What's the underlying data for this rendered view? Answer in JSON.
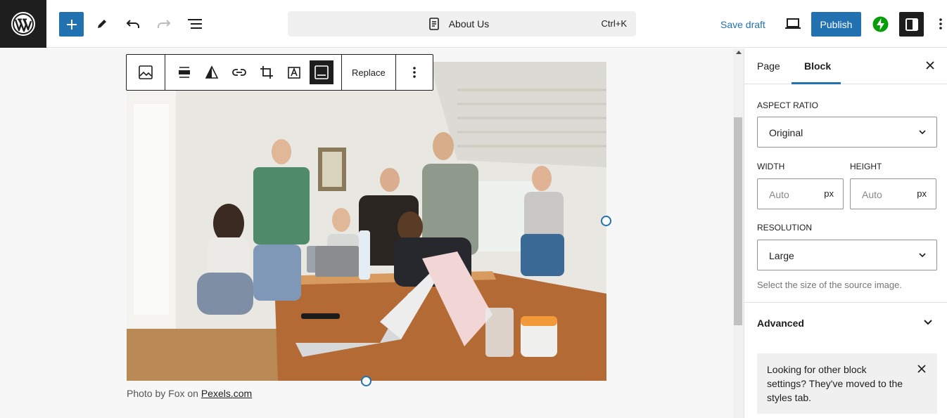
{
  "header": {
    "document_title": "About Us",
    "shortcut": "Ctrl+K",
    "save_draft_label": "Save draft",
    "publish_label": "Publish"
  },
  "block_toolbar": {
    "replace_label": "Replace"
  },
  "image": {
    "caption_prefix": "Photo by Fox on ",
    "caption_link": "Pexels.com"
  },
  "sidebar": {
    "tabs": [
      {
        "label": "Page"
      },
      {
        "label": "Block"
      }
    ],
    "aspect_ratio": {
      "label": "ASPECT RATIO",
      "value": "Original"
    },
    "width": {
      "label": "WIDTH",
      "placeholder": "Auto",
      "unit": "px"
    },
    "height": {
      "label": "HEIGHT",
      "placeholder": "Auto",
      "unit": "px"
    },
    "resolution": {
      "label": "RESOLUTION",
      "value": "Large",
      "help": "Select the size of the source image."
    },
    "advanced_label": "Advanced",
    "notice": "Looking for other block settings? They've moved to the styles tab."
  },
  "colors": {
    "accent": "#2271b1",
    "dark": "#1e1e1e",
    "jetpack": "#069e08"
  }
}
